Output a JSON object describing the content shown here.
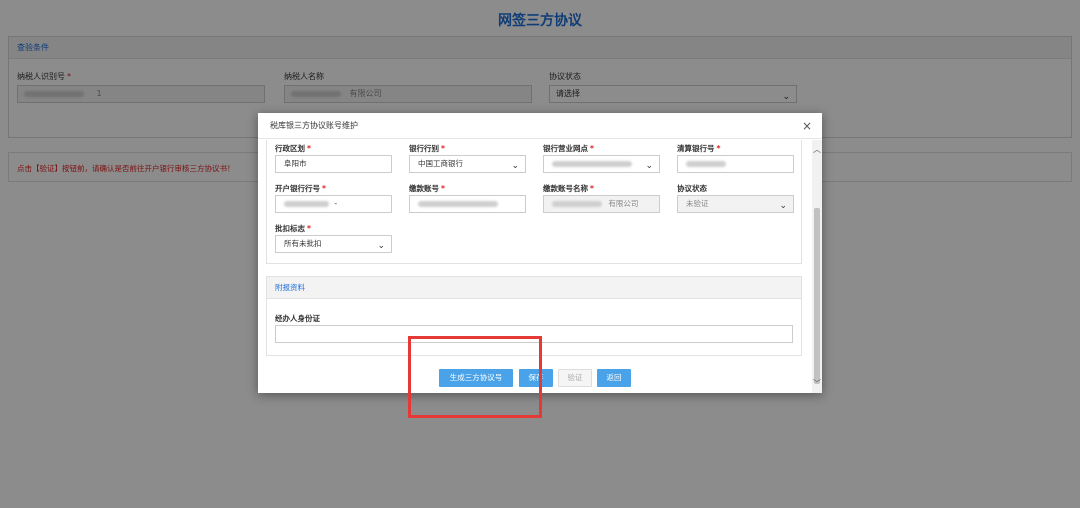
{
  "page": {
    "title": "网签三方协议",
    "query_panel": {
      "header": "查验条件",
      "taxpayer_id_label": "纳税人识别号",
      "taxpayer_id_value": "1",
      "taxpayer_name_label": "纳税人名称",
      "taxpayer_name_value": "有限公司",
      "agreement_status_label": "协议状态",
      "agreement_status_value": "请选择"
    },
    "notice": "点击【验证】按钮前，请确认是否前往开户银行审核三方协议书！"
  },
  "modal": {
    "title": "税库银三方协议账号维护",
    "close_symbol": "×",
    "fields": {
      "district_label": "行政区划",
      "district_value": "阜阳市",
      "bank_type_label": "银行行别",
      "bank_type_value": "中国工商银行",
      "bank_branch_label": "银行营业网点",
      "clearing_bank_label": "清算银行号",
      "open_bank_label": "开户银行行号",
      "open_bank_value": "-",
      "payment_account_label": "缴款账号",
      "payment_account_name_label": "缴款账号名称",
      "payment_account_name_value": "有限公司",
      "agreement_status_label": "协议状态",
      "agreement_status_value": "未验证",
      "batch_flag_label": "批扣标志",
      "batch_flag_value": "所有未批扣"
    },
    "attachment": {
      "header": "附报资料",
      "id_label": "经办人身份证",
      "id_value": ""
    },
    "buttons": {
      "generate": "生成三方协议号",
      "save": "保存",
      "verify": "验证",
      "back": "返回"
    }
  },
  "colors": {
    "accent": "#1e6fd9",
    "button": "#4aa3e8",
    "required": "#e02020",
    "highlight": "#e53935"
  }
}
